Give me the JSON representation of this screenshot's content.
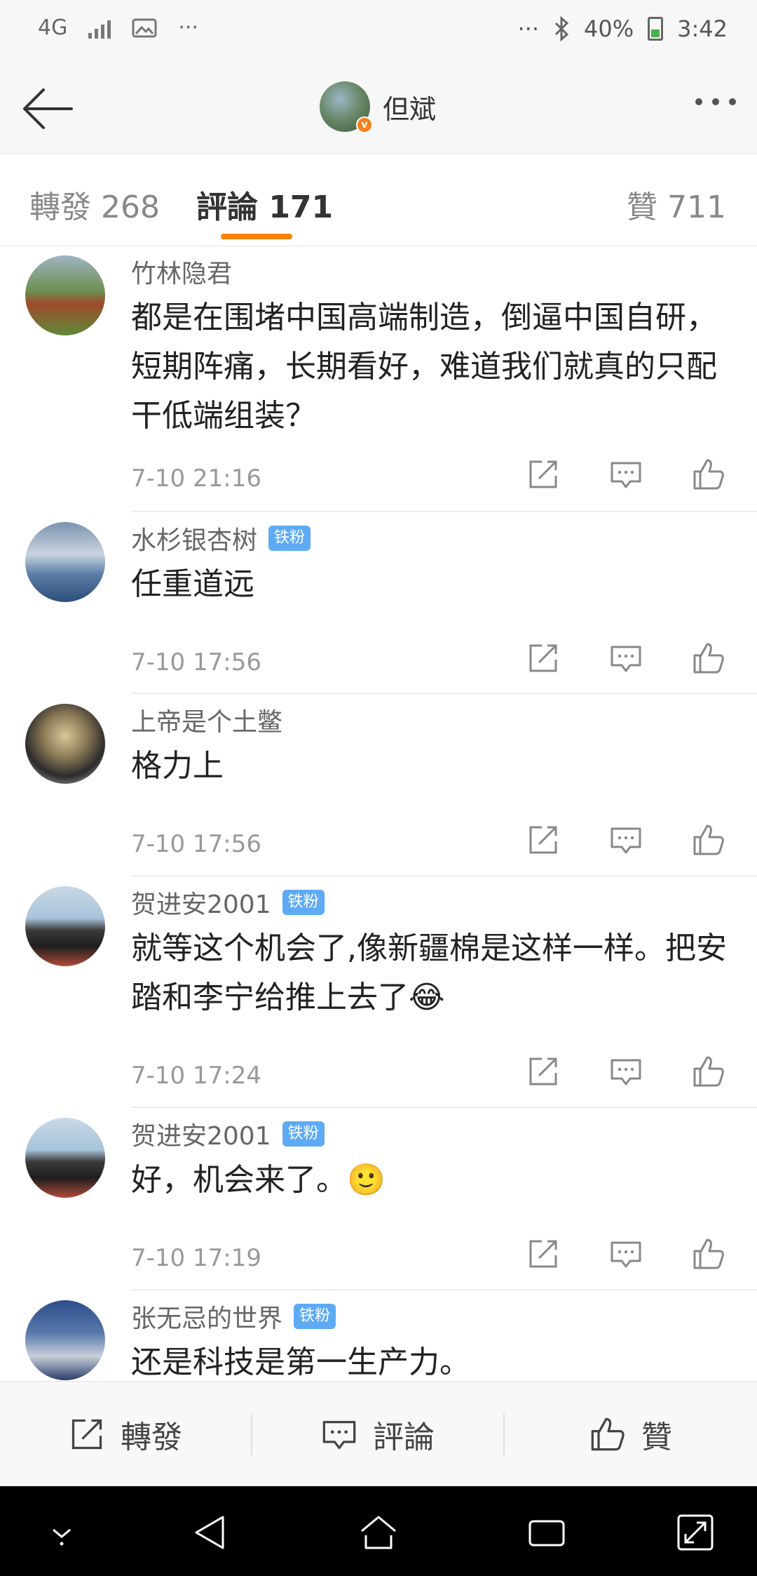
{
  "status_bar": {
    "network": "4G",
    "battery": "40%",
    "time": "3:42",
    "dots": "···"
  },
  "nav": {
    "title": "但斌"
  },
  "tabs": [
    {
      "label": "轉發 268"
    },
    {
      "label": "評論 171"
    },
    {
      "label": "贊 711"
    }
  ],
  "comments": [
    {
      "user": "竹林隐君",
      "badge": "",
      "text": "都是在围堵中国高端制造，倒逼中国自研，短期阵痛，长期看好，难道我们就真的只配干低端组装？",
      "time": "7-10 21:16"
    },
    {
      "user": "水杉银杏树",
      "badge": "铁粉",
      "text": "任重道远",
      "time": "7-10 17:56"
    },
    {
      "user": "上帝是个土鳖",
      "badge": "",
      "text": "格力上",
      "time": "7-10 17:56"
    },
    {
      "user": "贺进安2001",
      "badge": "铁粉",
      "text": "就等这个机会了,像新疆棉是这样一样。把安踏和李宁给推上去了😂",
      "time": "7-10 17:24"
    },
    {
      "user": "贺进安2001",
      "badge": "铁粉",
      "text": "好，机会来了。🙂",
      "time": "7-10 17:19"
    },
    {
      "user": "张无忌的世界",
      "badge": "铁粉",
      "text": "还是科技是第一生产力。",
      "time": ""
    }
  ],
  "bottom_bar": {
    "repost": "轉發",
    "comment": "評論",
    "like": "贊"
  },
  "colors": {
    "accent": "#ff8200",
    "badge": "#5eaaf5"
  }
}
